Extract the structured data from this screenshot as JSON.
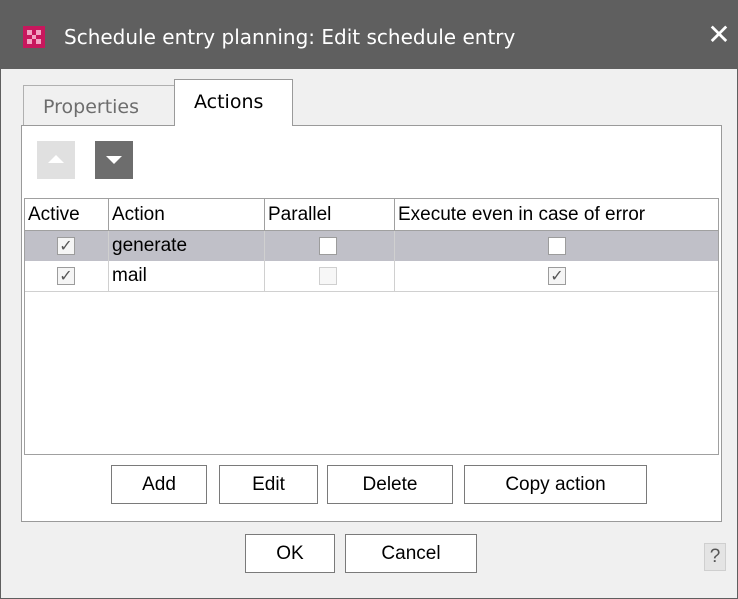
{
  "window": {
    "title": "Schedule entry planning:  Edit schedule entry",
    "close_glyph": "✕",
    "app_icon": "firstspirit-logo-icon",
    "title_bar_color": "#5f5f5f"
  },
  "tabs": [
    {
      "label": "Properties",
      "selected": false
    },
    {
      "label": "Actions",
      "selected": true
    }
  ],
  "toolbar": {
    "move_up": {
      "icon": "triangle-up-icon",
      "enabled": false
    },
    "move_down": {
      "icon": "triangle-down-icon",
      "enabled": true
    }
  },
  "table": {
    "columns": [
      "Active",
      "Action",
      "Parallel",
      "Execute even in case of error"
    ],
    "rows": [
      {
        "active": true,
        "action": "generate",
        "parallel": false,
        "execute_on_error": false,
        "selected": true
      },
      {
        "active": true,
        "action": "mail",
        "parallel": false,
        "execute_on_error": true,
        "selected": false
      }
    ],
    "selection_color": "#c0c0c8"
  },
  "panel_buttons": {
    "add": "Add",
    "edit": "Edit",
    "delete": "Delete",
    "copy": "Copy action"
  },
  "dialog_buttons": {
    "ok": "OK",
    "cancel": "Cancel",
    "help": "?"
  },
  "checkmark": "✓"
}
